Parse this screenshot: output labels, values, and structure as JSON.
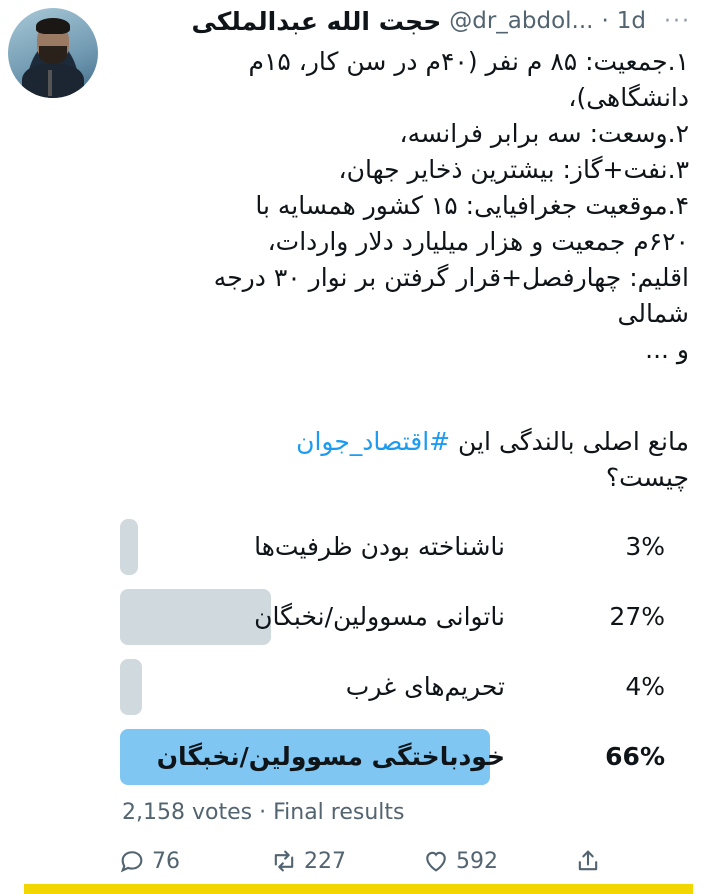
{
  "author": {
    "name": "حجت الله عبدالملکی",
    "handle": "@dr_abdol...",
    "time_sep": "·",
    "time": "1d",
    "more": "···"
  },
  "tweet": {
    "lines": [
      "۱.جمعیت: ۸۵ م نفر (۴۰م در سن کار، ۱۵م",
      "دانشگاهی)،",
      "۲.وسعت: سه برابر فرانسه،",
      "۳.نفت+گاز: بیشترین ذخایر جهان،",
      "۴.موقعیت جغرافیایی: ۱۵ کشور همسایه با",
      "۶۲۰م جمعیت و هزار میلیارد دلار واردات،",
      "اقلیم: چهارفصل+قرار گرفتن بر نوار ۳۰ درجه",
      "شمالی",
      "و ..."
    ],
    "question_prefix": "مانع اصلی بالندگی این ",
    "hashtag": "#اقتصاد_جوان",
    "question_suffix": "چیست؟"
  },
  "poll": {
    "options": [
      {
        "label": "ناشناخته بودن ظرفیت‌ها",
        "percent": "3%",
        "share": 0.03,
        "winner": false
      },
      {
        "label": "ناتوانی مسوولین/نخبگان",
        "percent": "27%",
        "share": 0.27,
        "winner": false
      },
      {
        "label": "تحریم‌های غرب",
        "percent": "4%",
        "share": 0.04,
        "winner": false
      },
      {
        "label": "خودباختگی مسوولین/نخبگان",
        "percent": "66%",
        "share": 0.66,
        "winner": true
      }
    ],
    "votes": "2,158 votes",
    "sep": "·",
    "status": "Final results"
  },
  "actions": {
    "reply_count": "76",
    "retweet_count": "227",
    "like_count": "592"
  },
  "colors": {
    "bar": "#cfd9de",
    "bar_winner": "#7fc6f2",
    "hashtag": "#1d9bf0",
    "footer_strip": "#f2d600"
  }
}
